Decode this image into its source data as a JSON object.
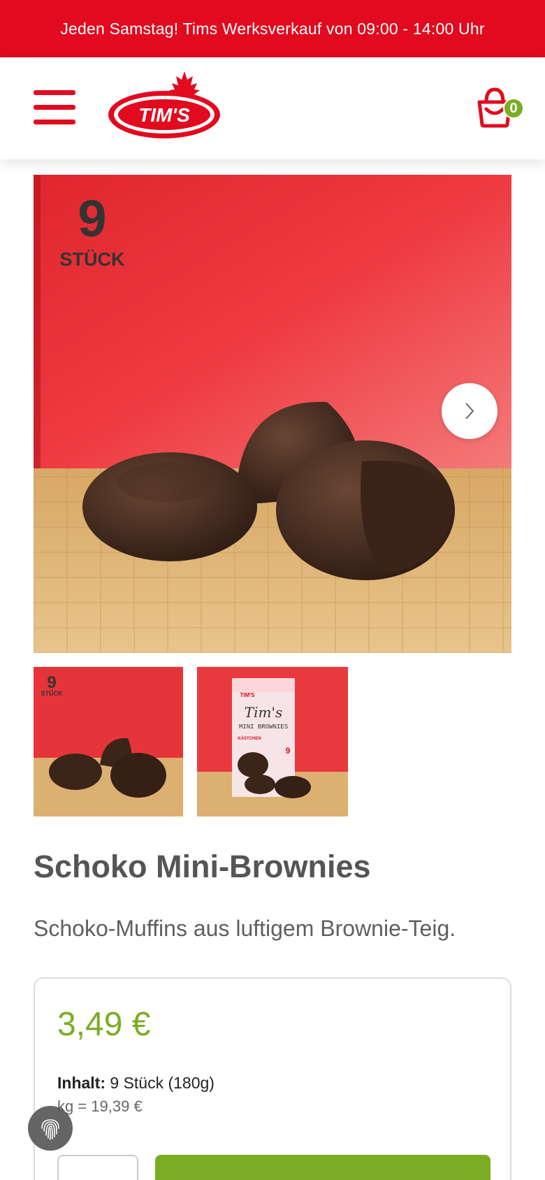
{
  "promo": {
    "text": "Jeden Samstag! Tims Werksverkauf von 09:00 - 14:00 Uhr"
  },
  "header": {
    "menu_icon": "hamburger-menu-icon",
    "logo_text": "TIM'S",
    "cart_icon": "shopping-basket-icon",
    "cart_count": "0"
  },
  "gallery": {
    "main_badge_number": "9",
    "main_badge_unit": "STÜCK",
    "next_icon": "chevron-right-icon",
    "thumb1_badge_number": "9",
    "thumb1_badge_unit": "STÜCK",
    "thumb2_brand": "TIM'S",
    "thumb2_script": "Tim's",
    "thumb2_product": "MINI BROWNIES",
    "thumb2_flavor": "KÄSTCHEN",
    "thumb2_count": "9"
  },
  "product": {
    "title": "Schoko Mini-Brownies",
    "subtitle": "Schoko-Muffins aus luftigem Brownie-Teig."
  },
  "purchase": {
    "price": "3,49 €",
    "content_label": "Inhalt:",
    "content_value": " 9 Stück (180g)",
    "unit_price": "kg = 19,39 €"
  },
  "colors": {
    "brand_red": "#e20a1e",
    "accent_green": "#7aad24",
    "text_gray": "#555555"
  },
  "privacy": {
    "icon": "fingerprint-icon"
  }
}
